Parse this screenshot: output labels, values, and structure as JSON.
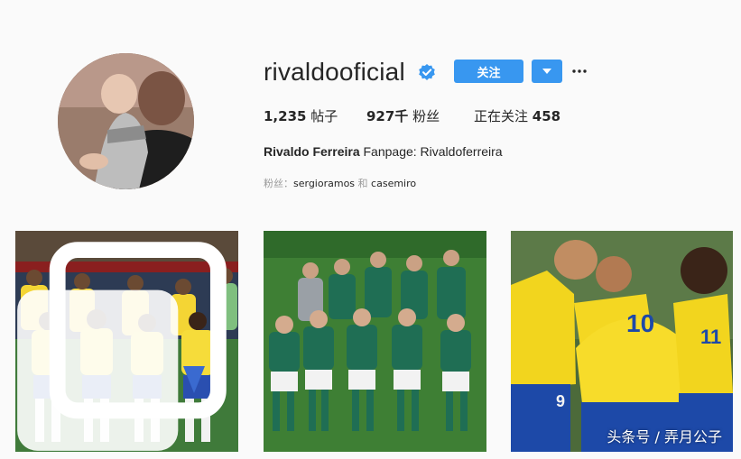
{
  "profile": {
    "username": "rivaldooficial",
    "verified": true,
    "follow_label": "关注",
    "more_label": "···"
  },
  "stats": {
    "posts_count": "1,235",
    "posts_label": "帖子",
    "followers_count": "927千",
    "followers_label": "粉丝",
    "following_label": "正在关注",
    "following_count": "458"
  },
  "bio": {
    "full_name": "Rivaldo Ferreira",
    "text": "Fanpage: Rivaldoferreira"
  },
  "followed_by": {
    "prefix": "粉丝：",
    "user1": "sergioramos",
    "joiner": "和",
    "user2": "casemiro"
  },
  "posts": [
    {
      "icon": "multiple-images-icon"
    },
    {
      "icon": ""
    },
    {
      "icon": ""
    }
  ],
  "watermark": "头条号 / 弄月公子",
  "colors": {
    "accent": "#3897f0",
    "verified_badge": "#3897f0",
    "text": "#262626",
    "muted": "#999999",
    "background": "#fafafa"
  }
}
